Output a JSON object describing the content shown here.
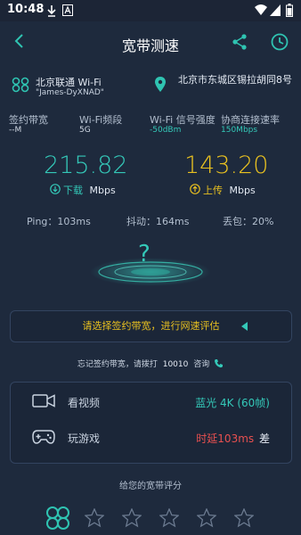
{
  "status_bar": {
    "time": "10:48"
  },
  "header": {
    "title": "宽带测速"
  },
  "network": {
    "isp": "北京联通 Wi-Fi",
    "ssid": "\"James-DyXNAD\"",
    "location": "北京市东城区锡拉胡同8号"
  },
  "stats": [
    {
      "label": "签约带宽",
      "value": "--M"
    },
    {
      "label": "Wi-Fi频段",
      "value": "5G"
    },
    {
      "label": "Wi-Fi 信号强度",
      "value": "-50dBm"
    },
    {
      "label": "协商连接速率",
      "value": "150Mbps"
    }
  ],
  "download": {
    "value": "215.82",
    "label": "下载",
    "unit": "Mbps"
  },
  "upload": {
    "value": "143.20",
    "label": "上传",
    "unit": "Mbps"
  },
  "metrics": {
    "ping": "Ping：103ms",
    "jitter": "抖动：164ms",
    "loss": "丢包：20%"
  },
  "gauge": {
    "symbol": "?"
  },
  "prompt": {
    "text": "请选择签约带宽，进行网速评估"
  },
  "hint": {
    "text": "忘记签约带宽，请拨打",
    "number": "10010",
    "suffix": "咨询"
  },
  "experience": {
    "video_label": "看视频",
    "video_prefix": "蓝光 4K (60帧)",
    "game_label": "玩游戏",
    "game_value": "时延103ms",
    "game_rating": "差"
  },
  "rating": {
    "title": "给您的宽带评分",
    "stars": 5
  },
  "colors": {
    "teal": "#34c8b8",
    "gold": "#e8c020",
    "red": "#e85050"
  }
}
